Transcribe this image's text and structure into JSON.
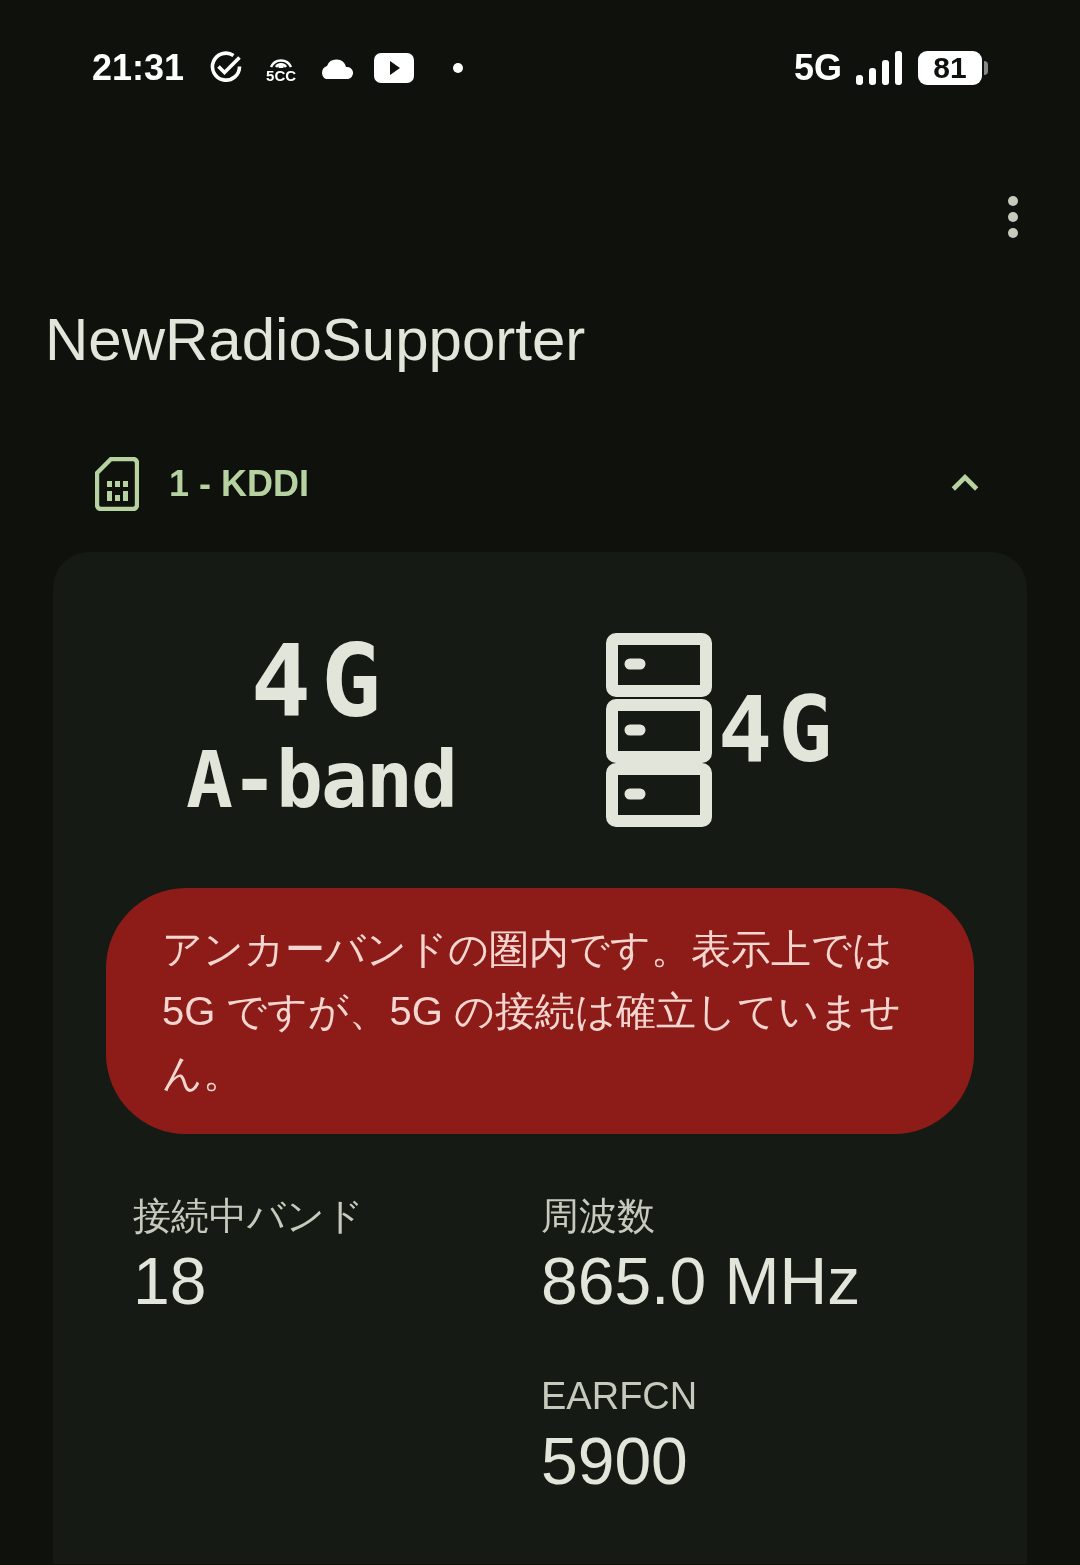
{
  "status_bar": {
    "time": "21:31",
    "notification_badge": "5CC",
    "network": "5G",
    "battery": "81"
  },
  "app_bar": {
    "title": "NewRadioSupporter"
  },
  "sim": {
    "label": "1 - KDDI",
    "expanded": true
  },
  "card": {
    "network_type": "4G",
    "band_type": "A-band",
    "stack_label": "4G",
    "warning": "アンカーバンドの圏内です。表示上では 5G ですが、5G の接続は確立していません。",
    "fields": [
      {
        "label": "接続中バンド",
        "value": "18"
      },
      {
        "label": "周波数",
        "value": "865.0 MHz"
      },
      {
        "label": "EARFCN",
        "value": "5900"
      }
    ]
  }
}
